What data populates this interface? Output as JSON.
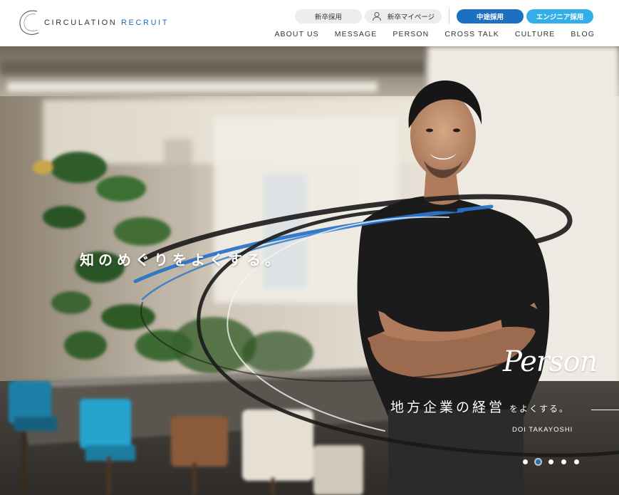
{
  "header": {
    "logo_text_main": "CIRCULATION",
    "logo_text_accent": "RECRUIT",
    "top_links": {
      "new_grad": "新卒採用",
      "mypage": "新卒マイページ",
      "mid_career": "中途採用",
      "engineer": "エンジニア採用"
    },
    "nav": [
      "ABOUT US",
      "MESSAGE",
      "PERSON",
      "CROSS TALK",
      "CULTURE",
      "BLOG"
    ]
  },
  "hero": {
    "catchphrase": "知のめぐりをよくする。",
    "section_script": "Person",
    "copy_main": "地方企業の経営",
    "copy_sub": "をよくする。",
    "person_name": "DOI TAKAYOSHI",
    "slides_total": 5,
    "active_slide": 2
  },
  "colors": {
    "brand_blue": "#1d6fc0",
    "engineer_cyan": "#33aee8",
    "pill_grey": "#ededed"
  },
  "icons": {
    "mypage": "person-icon"
  }
}
